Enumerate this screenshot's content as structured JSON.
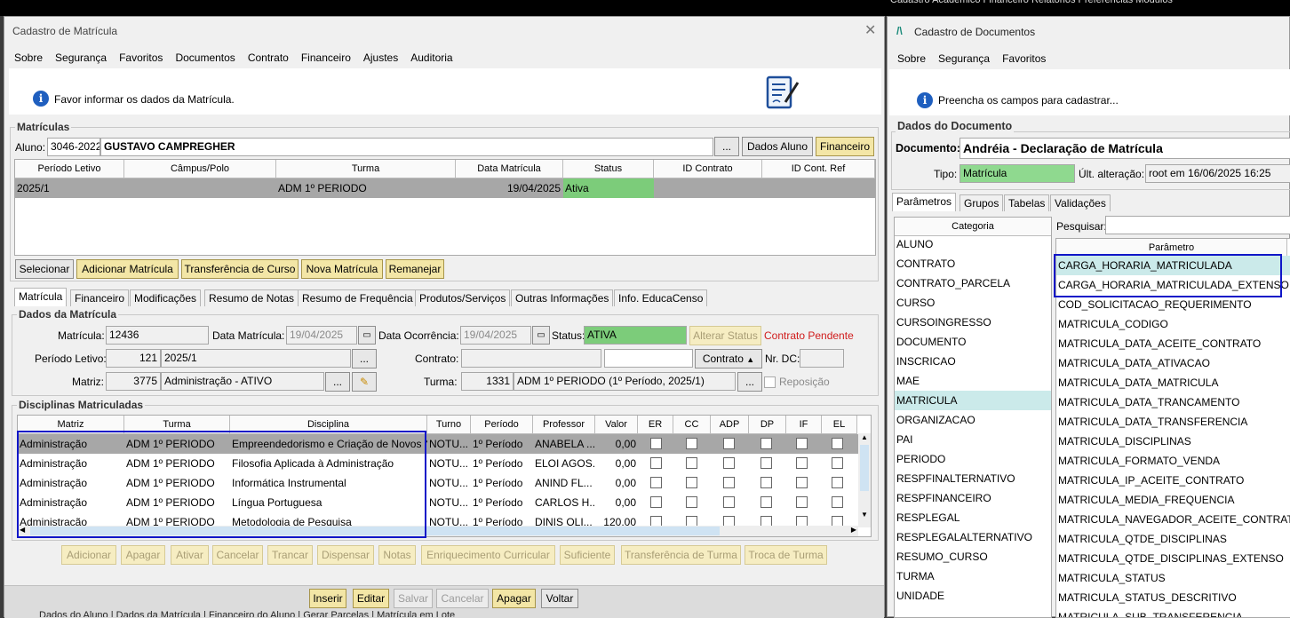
{
  "bg": {
    "menu": "Cadastro   Acadêmico   Financeiro   Relatórios   Preferências   Módulos"
  },
  "left": {
    "title": "Cadastro de Matrícula",
    "menu": [
      "Sobre",
      "Segurança",
      "Favoritos",
      "Documentos",
      "Contrato",
      "Financeiro",
      "Ajustes",
      "Auditoria"
    ],
    "info": "Favor informar os dados da Matrícula.",
    "matriculas": {
      "title": "Matrículas",
      "aluno_label": "Aluno:",
      "aluno_code": "3046-2022",
      "aluno_name": "GUSTAVO CAMPREGHER",
      "dots": "...",
      "btn_dados": "Dados Aluno",
      "btn_fin": "Financeiro",
      "headers": [
        "Período Letivo",
        "Câmpus/Polo",
        "Turma",
        "Data Matrícula",
        "Status",
        "ID Contrato",
        "ID Cont. Ref"
      ],
      "row": {
        "periodo": "2025/1",
        "campus": "",
        "turma": "ADM 1º PERIODO",
        "data": "19/04/2025",
        "status": "Ativa",
        "idc": "",
        "idr": ""
      }
    },
    "actions": [
      "Selecionar",
      "Adicionar Matrícula",
      "Transferência de Curso",
      "Nova Matrícula",
      "Remanejar"
    ],
    "tabs": [
      "Matrícula",
      "Financeiro",
      "Modificações",
      "Resumo de Notas",
      "Resumo de Frequência",
      "Produtos/Serviços",
      "Outras Informações",
      "Info. EducaCenso"
    ],
    "dados": {
      "title": "Dados da Matrícula",
      "matricula_label": "Matrícula:",
      "matricula": "12436",
      "data_mat_label": "Data Matrícula:",
      "data_mat": "19/04/2025",
      "data_oc_label": "Data Ocorrência:",
      "data_oc": "19/04/2025",
      "status_label": "Status:",
      "status": "ATIVA",
      "alterar": "Alterar Status",
      "pendente": "Contrato Pendente",
      "periodo_label": "Período Letivo:",
      "periodo_code": "121",
      "periodo": "2025/1",
      "contrato_label": "Contrato:",
      "contrato_btn": "Contrato",
      "nrdc_label": "Nr. DC:",
      "matriz_label": "Matriz:",
      "matriz_code": "3775",
      "matriz": "Administração - ATIVO",
      "turma_label": "Turma:",
      "turma_code": "1331",
      "turma": "ADM 1º PERIODO (1º Período, 2025/1)",
      "reposicao": "Reposição"
    },
    "disc": {
      "title": "Disciplinas Matriculadas",
      "headers": [
        "Matriz",
        "Turma",
        "Disciplina",
        "Turno",
        "Período",
        "Professor",
        "Valor",
        "ER",
        "CC",
        "ADP",
        "DP",
        "IF",
        "EL"
      ],
      "rows": [
        {
          "matriz": "Administração",
          "turma": "ADM 1º PERIODO",
          "disciplina": "Empreendedorismo e Criação de Novos Negócios",
          "turno": "NOTU...",
          "periodo": "1º Período",
          "prof": "ANABELA ...",
          "valor": "0,00"
        },
        {
          "matriz": "Administração",
          "turma": "ADM 1º PERIODO",
          "disciplina": "Filosofia Aplicada à Administração",
          "turno": "NOTU...",
          "periodo": "1º Período",
          "prof": "ELOI AGOS...",
          "valor": "0,00"
        },
        {
          "matriz": "Administração",
          "turma": "ADM 1º PERIODO",
          "disciplina": "Informática Instrumental",
          "turno": "NOTU...",
          "periodo": "1º Período",
          "prof": "ANIND FL...",
          "valor": "0,00"
        },
        {
          "matriz": "Administração",
          "turma": "ADM 1º PERIODO",
          "disciplina": "Língua Portuguesa",
          "turno": "NOTU...",
          "periodo": "1º Período",
          "prof": "CARLOS H...",
          "valor": "0,00"
        },
        {
          "matriz": "Administração",
          "turma": "ADM 1º PERIODO",
          "disciplina": "Metodologia de Pesquisa",
          "turno": "NOTU...",
          "periodo": "1º Período",
          "prof": "DINIS OLI...",
          "valor": "120,00"
        }
      ]
    },
    "disc_actions": [
      "Adicionar",
      "Apagar",
      "Ativar",
      "Cancelar",
      "Trancar",
      "Dispensar",
      "Notas",
      "Enriquecimento Curricular",
      "Suficiente",
      "Transferência de Turma",
      "Troca de Turma"
    ],
    "footer": [
      "Inserir",
      "Editar",
      "Salvar",
      "Cancelar",
      "Apagar",
      "Voltar"
    ],
    "bottom_tabs": "Dados do Aluno | Dados da Matrícula | Financeiro do Aluno | Gerar Parcelas | Matrícula em Lote"
  },
  "right": {
    "title": "Cadastro de Documentos",
    "menu": [
      "Sobre",
      "Segurança",
      "Favoritos"
    ],
    "info": "Preencha os campos para cadastrar...",
    "group": "Dados do Documento",
    "doc_label": "Documento:",
    "doc": "Andréia - Declaração de Matrícula",
    "tipo_label": "Tipo:",
    "tipo": "Matrícula",
    "ult_label": "Últ. alteração:",
    "ult": "root em 16/06/2025 16:25",
    "tabs": [
      "Parâmetros",
      "Grupos",
      "Tabelas",
      "Validações"
    ],
    "cat_header": "Categoria",
    "categorias": [
      "ALUNO",
      "CONTRATO",
      "CONTRATO_PARCELA",
      "CURSO",
      "CURSOINGRESSO",
      "DOCUMENTO",
      "INSCRICAO",
      "MAE",
      "MATRICULA",
      "ORGANIZACAO",
      "PAI",
      "PERIODO",
      "RESPFINALTERNATIVO",
      "RESPFINANCEIRO",
      "RESPLEGAL",
      "RESPLEGALALTERNATIVO",
      "RESUMO_CURSO",
      "TURMA",
      "UNIDADE"
    ],
    "pesquisar": "Pesquisar:",
    "param_header": "Parâmetro",
    "parametros": [
      "CARGA_HORARIA_MATRICULADA",
      "CARGA_HORARIA_MATRICULADA_EXTENSO",
      "COD_SOLICITACAO_REQUERIMENTO",
      "MATRICULA_CODIGO",
      "MATRICULA_DATA_ACEITE_CONTRATO",
      "MATRICULA_DATA_ATIVACAO",
      "MATRICULA_DATA_MATRICULA",
      "MATRICULA_DATA_TRANCAMENTO",
      "MATRICULA_DATA_TRANSFERENCIA",
      "MATRICULA_DISCIPLINAS",
      "MATRICULA_FORMATO_VENDA",
      "MATRICULA_IP_ACEITE_CONTRATO",
      "MATRICULA_MEDIA_FREQUENCIA",
      "MATRICULA_NAVEGADOR_ACEITE_CONTRATO",
      "MATRICULA_QTDE_DISCIPLINAS",
      "MATRICULA_QTDE_DISCIPLINAS_EXTENSO",
      "MATRICULA_STATUS",
      "MATRICULA_STATUS_DESCRITIVO",
      "MATRICULA_SUB_TRANSFERENCIA"
    ]
  }
}
